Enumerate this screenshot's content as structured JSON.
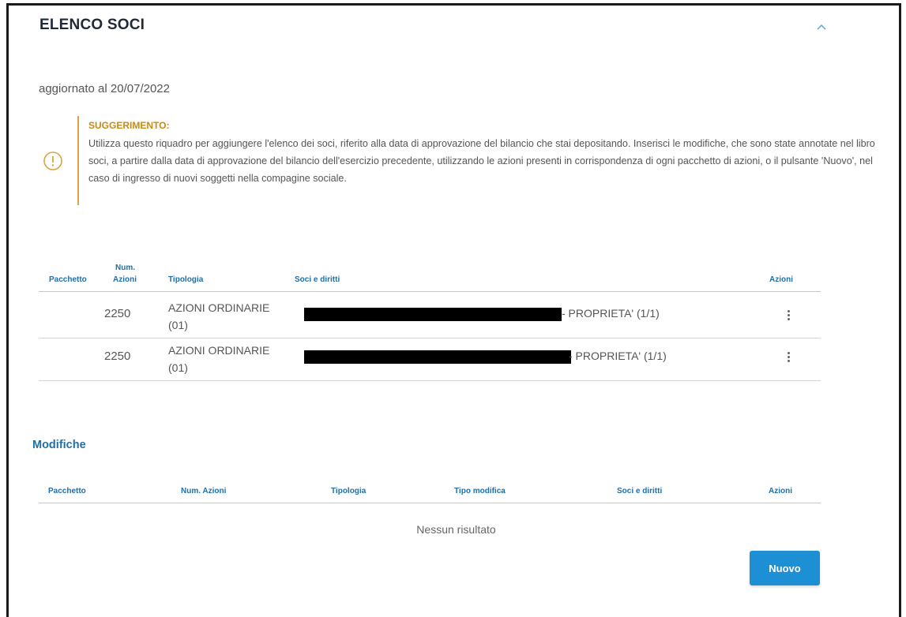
{
  "section_title": "ELENCO SOCI",
  "updated_text": "aggiornato al 20/07/2022",
  "tip": {
    "title": "SUGGERIMENTO:",
    "body": "Utilizza questo riquadro per aggiungere l'elenco dei soci, riferito alla data di approvazione del bilancio che stai depositando. Inserisci le modifiche, che sono state annotate nel libro soci, a partire dalla data di approvazione del bilancio dell'esercizio precedente, utilizzando le azioni presenti in corrispondenza di ogni pacchetto di azioni, o il pulsante 'Nuovo', nel caso di ingresso di nuovi soggetti nella compagine sociale.",
    "icon": "alert-circle-icon",
    "accent": "#c98a12"
  },
  "soci_table": {
    "headers": {
      "pacchetto": "Pacchetto",
      "num_azioni_1": "Num.",
      "num_azioni_2": "Azioni",
      "tipologia": "Tipologia",
      "soci": "Soci e diritti",
      "azioni": "Azioni"
    },
    "rows": [
      {
        "num": "2250",
        "tipologia_1": "AZIONI ORDINARIE",
        "tipologia_2": "(01)",
        "diritto": "- PROPRIETA' (1/1)"
      },
      {
        "num": "2250",
        "tipologia_1": "AZIONI ORDINARIE",
        "tipologia_2": "(01)",
        "diritto": "- PROPRIETA' (1/1)"
      }
    ]
  },
  "modifiche": {
    "title": "Modifiche",
    "headers": {
      "pacchetto": "Pacchetto",
      "num_azioni": "Num. Azioni",
      "tipologia": "Tipologia",
      "tipo_modifica": "Tipo modifica",
      "soci": "Soci e diritti",
      "azioni": "Azioni"
    },
    "empty_text": "Nessun risultato"
  },
  "new_button": "Nuovo",
  "colors": {
    "link_blue": "#1f6fa8",
    "button_blue": "#1d8fd4"
  }
}
